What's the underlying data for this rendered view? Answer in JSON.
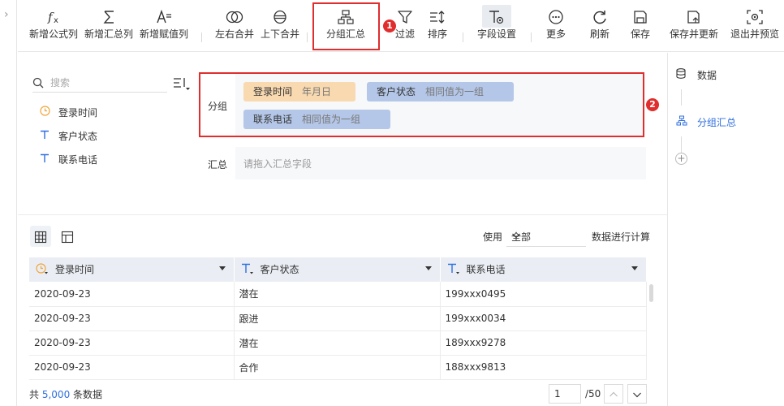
{
  "toolbar": {
    "items": [
      {
        "label": "新增公式列",
        "icon": "fx-icon"
      },
      {
        "label": "新增汇总列",
        "icon": "sigma-icon"
      },
      {
        "label": "新增赋值列",
        "icon": "assign-icon"
      },
      {
        "label": "左右合并",
        "icon": "merge-horizontal-icon"
      },
      {
        "label": "上下合并",
        "icon": "merge-vertical-icon"
      },
      {
        "label": "分组汇总",
        "icon": "group-summary-icon"
      },
      {
        "label": "过滤",
        "icon": "filter-icon"
      },
      {
        "label": "排序",
        "icon": "sort-icon"
      },
      {
        "label": "字段设置",
        "icon": "field-settings-icon"
      },
      {
        "label": "更多",
        "icon": "more-icon"
      },
      {
        "label": "刷新",
        "icon": "refresh-icon"
      },
      {
        "label": "保存",
        "icon": "save-icon"
      },
      {
        "label": "保存并更新",
        "icon": "save-update-icon"
      },
      {
        "label": "退出并预览",
        "icon": "exit-preview-icon"
      }
    ]
  },
  "annotations": {
    "badge1": "1",
    "badge2": "2"
  },
  "field_panel": {
    "search_placeholder": "搜索",
    "fields": [
      {
        "name": "登录时间",
        "type": "date"
      },
      {
        "name": "客户状态",
        "type": "text"
      },
      {
        "name": "联系电话",
        "type": "text"
      }
    ]
  },
  "config": {
    "group_label": "分组",
    "summary_label": "汇总",
    "summary_placeholder": "请拖入汇总字段",
    "group_chips": [
      {
        "field": "登录时间",
        "mode": "年月日"
      },
      {
        "field": "客户状态",
        "mode": "相同值为一组"
      },
      {
        "field": "联系电话",
        "mode": "相同值为一组"
      }
    ]
  },
  "right_panel": {
    "steps": [
      {
        "label": "数据",
        "icon": "database-icon"
      },
      {
        "label": "分组汇总",
        "icon": "group-summary-icon"
      }
    ],
    "add_label": "+"
  },
  "data_calc": {
    "use_label": "使用",
    "selected": "全部",
    "suffix": "数据进行计算"
  },
  "table": {
    "columns": [
      {
        "label": "登录时间",
        "type": "date"
      },
      {
        "label": "客户状态",
        "type": "text"
      },
      {
        "label": "联系电话",
        "type": "text"
      }
    ],
    "rows": [
      [
        "2020-09-23",
        "潜在",
        "199xxx0495"
      ],
      [
        "2020-09-23",
        "跟进",
        "199xxx0034"
      ],
      [
        "2020-09-23",
        "潜在",
        "189xxx9278"
      ],
      [
        "2020-09-23",
        "合作",
        "188xxx9813"
      ]
    ]
  },
  "footer": {
    "total_prefix": "共",
    "total_count": "5,000",
    "total_suffix": "条数据",
    "page_current": "1",
    "page_total": "/50"
  },
  "colors": {
    "accent_red": "#e02d2d",
    "date_chip": "#f8d9b0",
    "dim_chip": "#b5c7e8",
    "link_blue": "#2f6fdf"
  }
}
